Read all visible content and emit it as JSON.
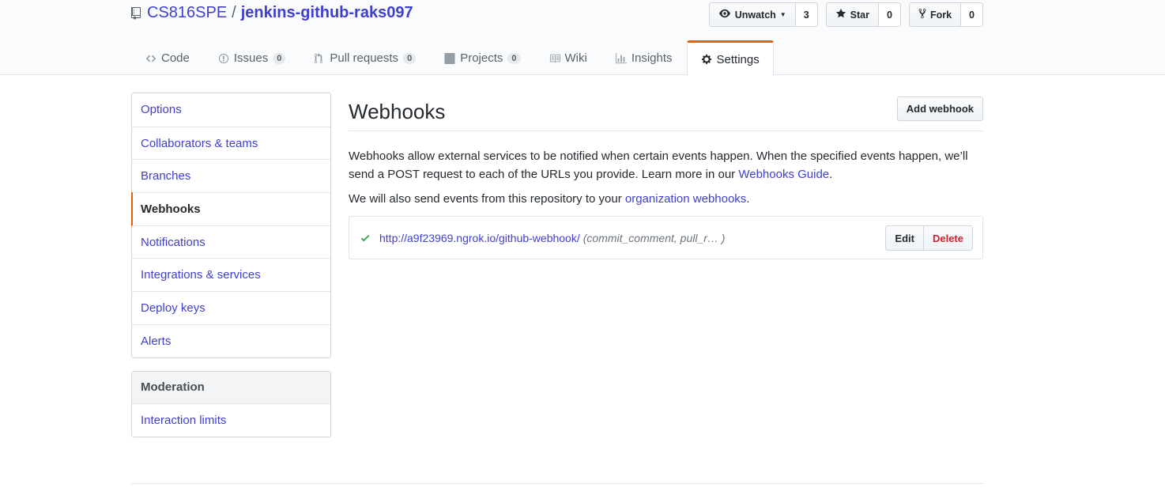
{
  "repo": {
    "owner": "CS816SPE",
    "separator": "/",
    "name": "jenkins-github-raks097"
  },
  "actions": {
    "watch": {
      "label": "Unwatch",
      "count": "3"
    },
    "star": {
      "label": "Star",
      "count": "0"
    },
    "fork": {
      "label": "Fork",
      "count": "0"
    }
  },
  "tabs": [
    {
      "label": "Code",
      "icon": "code-icon"
    },
    {
      "label": "Issues",
      "count": "0",
      "icon": "issue-icon"
    },
    {
      "label": "Pull requests",
      "count": "0",
      "icon": "pull-request-icon"
    },
    {
      "label": "Projects",
      "count": "0",
      "icon": "project-icon"
    },
    {
      "label": "Wiki",
      "icon": "book-icon"
    },
    {
      "label": "Insights",
      "icon": "graph-icon"
    },
    {
      "label": "Settings",
      "icon": "gear-icon",
      "selected": true
    }
  ],
  "sidebar": {
    "items": [
      {
        "label": "Options"
      },
      {
        "label": "Collaborators & teams"
      },
      {
        "label": "Branches"
      },
      {
        "label": "Webhooks",
        "selected": true
      },
      {
        "label": "Notifications"
      },
      {
        "label": "Integrations & services"
      },
      {
        "label": "Deploy keys"
      },
      {
        "label": "Alerts"
      }
    ],
    "moderation": {
      "heading": "Moderation",
      "items": [
        {
          "label": "Interaction limits"
        }
      ]
    }
  },
  "main": {
    "title": "Webhooks",
    "add_button": "Add webhook",
    "description_part1": "Webhooks allow external services to be notified when certain events happen. When the specified events happen, we’ll send a POST request to each of the URLs you provide. Learn more in our ",
    "description_link": "Webhooks Guide",
    "description_part2": ".",
    "org_text": "We will also send events from this repository to your ",
    "org_link": "organization webhooks",
    "org_end": ".",
    "hooks": [
      {
        "url": "http://a9f23969.ngrok.io/github-webhook/",
        "events": "(commit_comment, pull_r… )",
        "status": "success",
        "edit_label": "Edit",
        "delete_label": "Delete"
      }
    ]
  },
  "colors": {
    "link": "#3f3fcf",
    "accent": "#e36209",
    "success": "#28a745",
    "danger": "#cb2431"
  }
}
